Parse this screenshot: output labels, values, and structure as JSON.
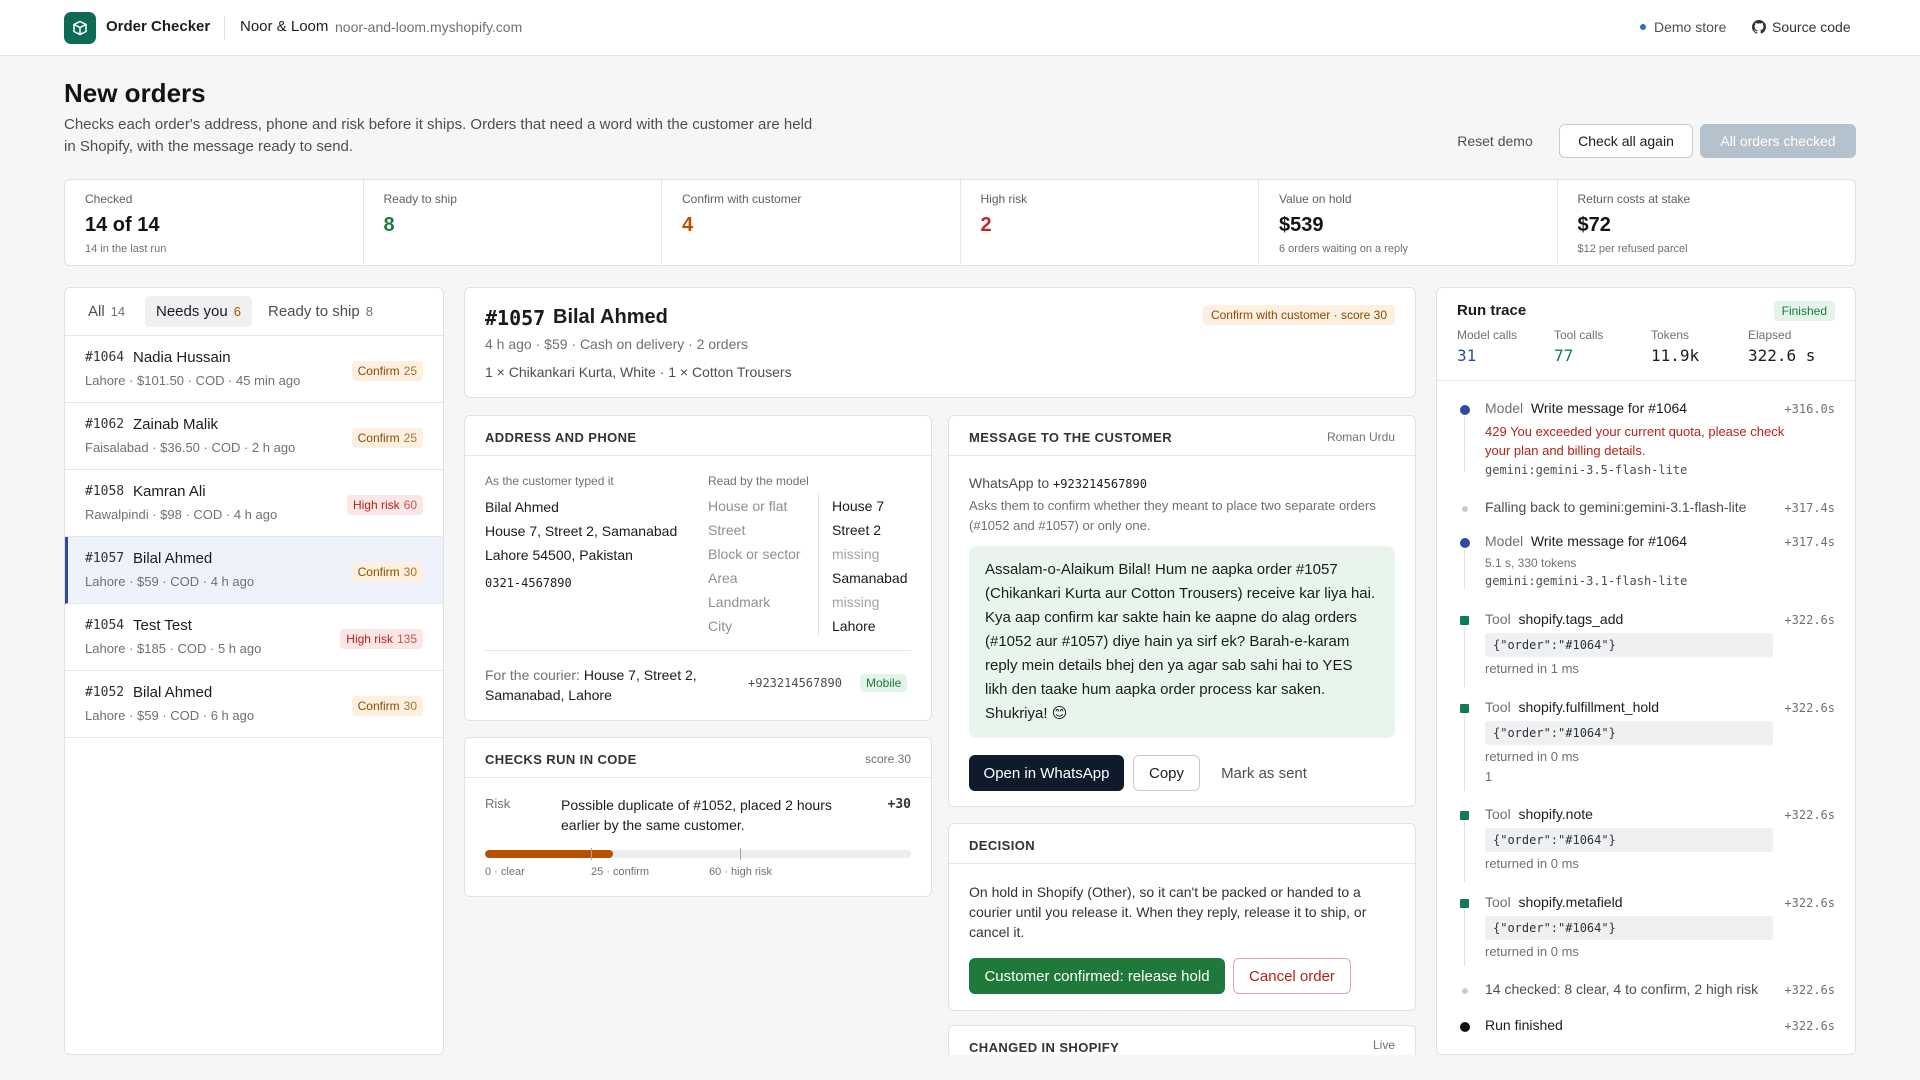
{
  "topbar": {
    "app_name": "Order Checker",
    "store_name": "Noor & Loom",
    "store_domain": "noor-and-loom.myshopify.com",
    "demo_label": "Demo store",
    "source_label": "Source code"
  },
  "header": {
    "title": "New orders",
    "subtitle": "Checks each order's address, phone and risk before it ships. Orders that need a word with the customer are held in Shopify, with the message ready to send.",
    "reset_label": "Reset demo",
    "check_again_label": "Check all again",
    "all_checked_label": "All orders checked"
  },
  "stats": [
    {
      "label": "Checked",
      "value": "14 of 14",
      "sub": "14 in the last run",
      "color": "#111315"
    },
    {
      "label": "Ready to ship",
      "value": "8",
      "sub": "",
      "color": "#1e7a3c"
    },
    {
      "label": "Confirm with customer",
      "value": "4",
      "sub": "",
      "color": "#b95000"
    },
    {
      "label": "High risk",
      "value": "2",
      "sub": "",
      "color": "#c0262d"
    },
    {
      "label": "Value on hold",
      "value": "$539",
      "sub": "6 orders waiting on a reply",
      "color": "#111315"
    },
    {
      "label": "Return costs at stake",
      "value": "$72",
      "sub": "$12 per refused parcel",
      "color": "#111315"
    }
  ],
  "tabs": [
    {
      "label": "All",
      "count": "14"
    },
    {
      "label": "Needs you",
      "count": "6"
    },
    {
      "label": "Ready to ship",
      "count": "8"
    }
  ],
  "orders": [
    {
      "id": "#1064",
      "name": "Nadia Hussain",
      "meta": "Lahore · $101.50 · COD · 45 min ago",
      "badge": "Confirm",
      "score": "25"
    },
    {
      "id": "#1062",
      "name": "Zainab Malik",
      "meta": "Faisalabad · $36.50 · COD · 2 h ago",
      "badge": "Confirm",
      "score": "25"
    },
    {
      "id": "#1058",
      "name": "Kamran Ali",
      "meta": "Rawalpindi · $98 · COD · 4 h ago",
      "badge": "High risk",
      "score": "60"
    },
    {
      "id": "#1057",
      "name": "Bilal Ahmed",
      "meta": "Lahore · $59 · COD · 4 h ago",
      "badge": "Confirm",
      "score": "30"
    },
    {
      "id": "#1054",
      "name": "Test Test",
      "meta": "Lahore · $185 · COD · 5 h ago",
      "badge": "High risk",
      "score": "135"
    },
    {
      "id": "#1052",
      "name": "Bilal Ahmed",
      "meta": "Lahore · $59 · COD · 6 h ago",
      "badge": "Confirm",
      "score": "30"
    }
  ],
  "detail": {
    "id": "#1057",
    "name": "Bilal Ahmed",
    "badge": "Confirm with customer · score 30",
    "meta": "4 h ago · $59 · Cash on delivery · 2 orders",
    "items": "1 × Chikankari Kurta, White · 1 × Cotton Trousers"
  },
  "address": {
    "title": "ADDRESS AND PHONE",
    "typed_label": "As the customer typed it",
    "typed_lines": [
      "Bilal Ahmed",
      "House 7, Street 2, Samanabad",
      "Lahore 54500, Pakistan"
    ],
    "typed_phone": "0321-4567890",
    "model_label": "Read by the model",
    "fields": [
      {
        "k": "House or flat",
        "v": "House 7"
      },
      {
        "k": "Street",
        "v": "Street 2"
      },
      {
        "k": "Block or sector",
        "v": "missing"
      },
      {
        "k": "Area",
        "v": "Samanabad"
      },
      {
        "k": "Landmark",
        "v": "missing"
      },
      {
        "k": "City",
        "v": "Lahore"
      }
    ],
    "courier_label": "For the courier:",
    "courier_value": "House 7, Street 2, Samanabad, Lahore",
    "courier_phone": "+923214567890",
    "phone_type": "Mobile"
  },
  "checks": {
    "title": "CHECKS RUN IN CODE",
    "score": "score 30",
    "row_label": "Risk",
    "row_text": "Possible duplicate of #1052, placed 2 hours earlier by the same customer.",
    "row_points": "+30",
    "scale_value": 30,
    "scale_max": 100,
    "ticks": [
      "0 · clear",
      "25 · confirm",
      "60 · high risk"
    ]
  },
  "message": {
    "title": "MESSAGE TO THE CUSTOMER",
    "language": "Roman Urdu",
    "to_label": "WhatsApp to",
    "to_number": "+923214567890",
    "desc": "Asks them to confirm whether they meant to place two separate orders (#1052 and #1057) or only one.",
    "body": "Assalam-o-Alaikum Bilal! Hum ne aapka order #1057 (Chikankari Kurta aur Cotton Trousers) receive kar liya hai. Kya aap confirm kar sakte hain ke aapne do alag orders (#1052 aur #1057) diye hain ya sirf ek? Barah-e-karam reply mein details bhej den ya agar sab sahi hai to YES likh den taake hum aapka order process kar saken. Shukriya! 😊",
    "open_label": "Open in WhatsApp",
    "copy_label": "Copy",
    "sent_label": "Mark as sent"
  },
  "decision": {
    "title": "DECISION",
    "text": "On hold in Shopify (Other), so it can't be packed or handed to a courier until you release it. When they reply, release it to ship, or cancel it.",
    "release_label": "Customer confirmed: release hold",
    "cancel_label": "Cancel order"
  },
  "changed": {
    "title": "CHANGED IN SHOPIFY",
    "status": "Live"
  },
  "trace": {
    "title": "Run trace",
    "status": "Finished",
    "metrics": [
      {
        "label": "Model calls",
        "value": "31"
      },
      {
        "label": "Tool calls",
        "value": "77"
      },
      {
        "label": "Tokens",
        "value": "11.9k"
      },
      {
        "label": "Elapsed",
        "value": "322.6 s"
      }
    ],
    "events": [
      {
        "kind": "Model",
        "name": "Write message for #1064",
        "time": "+316.0s",
        "error": "429 You exceeded your current quota, please check your plan and billing details.",
        "code": "gemini:gemini-3.5-flash-lite"
      },
      {
        "text": "Falling back to gemini:gemini-3.1-flash-lite",
        "time": "+317.4s"
      },
      {
        "kind": "Model",
        "name": "Write message for #1064",
        "time": "+317.4s",
        "sub": "5.1 s, 330 tokens",
        "code": "gemini:gemini-3.1-flash-lite"
      },
      {
        "kind": "Tool",
        "name": "shopify.tags_add",
        "time": "+322.6s",
        "args": "{\"order\":\"#1064\"}",
        "result": "returned in 1 ms"
      },
      {
        "kind": "Tool",
        "name": "shopify.fulfillment_hold",
        "time": "+322.6s",
        "args": "{\"order\":\"#1064\"}",
        "result": "returned in 0 ms",
        "extra": "1"
      },
      {
        "kind": "Tool",
        "name": "shopify.note",
        "time": "+322.6s",
        "args": "{\"order\":\"#1064\"}",
        "result": "returned in 0 ms"
      },
      {
        "kind": "Tool",
        "name": "shopify.metafield",
        "time": "+322.6s",
        "args": "{\"order\":\"#1064\"}",
        "result": "returned in 0 ms"
      },
      {
        "text": "14 checked: 8 clear, 4 to confirm, 2 high risk",
        "time": "+322.6s"
      },
      {
        "text": "Run finished",
        "time": "+322.6s"
      }
    ]
  },
  "colors": {
    "brand": "#0e6b55",
    "accent_blue": "#2c4d9e",
    "confirm": "#b95000",
    "risk": "#c0262d",
    "whatsapp_btn": "#0f1b2d",
    "release_btn": "#1f7a3a"
  }
}
